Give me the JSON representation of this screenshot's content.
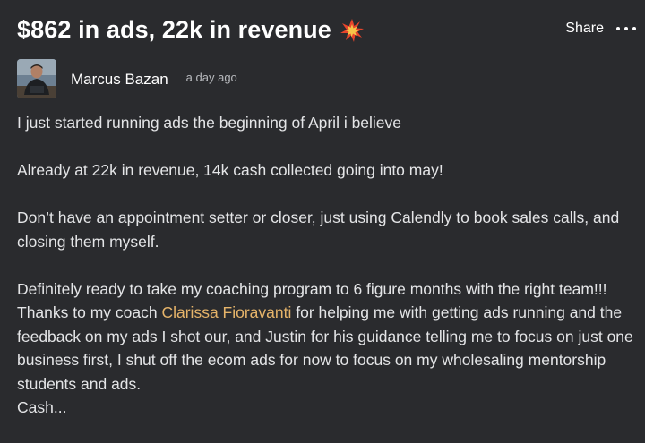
{
  "post": {
    "title": "$862 in ads, 22k in revenue",
    "title_emoji": "collision-emoji-icon",
    "share_label": "Share",
    "more_icon": "more-horizontal-icon",
    "author": {
      "name": "Marcus Bazan",
      "timestamp": "a day ago",
      "avatar": "avatar-photo"
    },
    "body": {
      "p1": "I just started running ads the beginning of April i believe",
      "p2": "Already at 22k in revenue, 14k cash collected going into may!",
      "p3": "Don’t have an appointment setter or closer, just using Calendly to book sales calls, and closing them myself.",
      "p4_line1": "Definitely ready to take my coaching program to 6 figure months with the right team!!!",
      "p4_before_mention": "Thanks to my coach ",
      "p4_mention": "Clarissa Fioravanti",
      "p4_after_mention": " for helping me with getting ads running and the feedback on my ads I shot our, and Justin for his guidance telling me to focus on just one business first, I shut off the ecom ads for now to focus on my wholesaling mentorship students and ads.",
      "p5": "Cash..."
    }
  },
  "colors": {
    "background": "#2a2b2e",
    "text": "#e4e5e7",
    "title": "#ffffff",
    "mention": "#e6b46a",
    "muted": "#b7b9bd"
  }
}
